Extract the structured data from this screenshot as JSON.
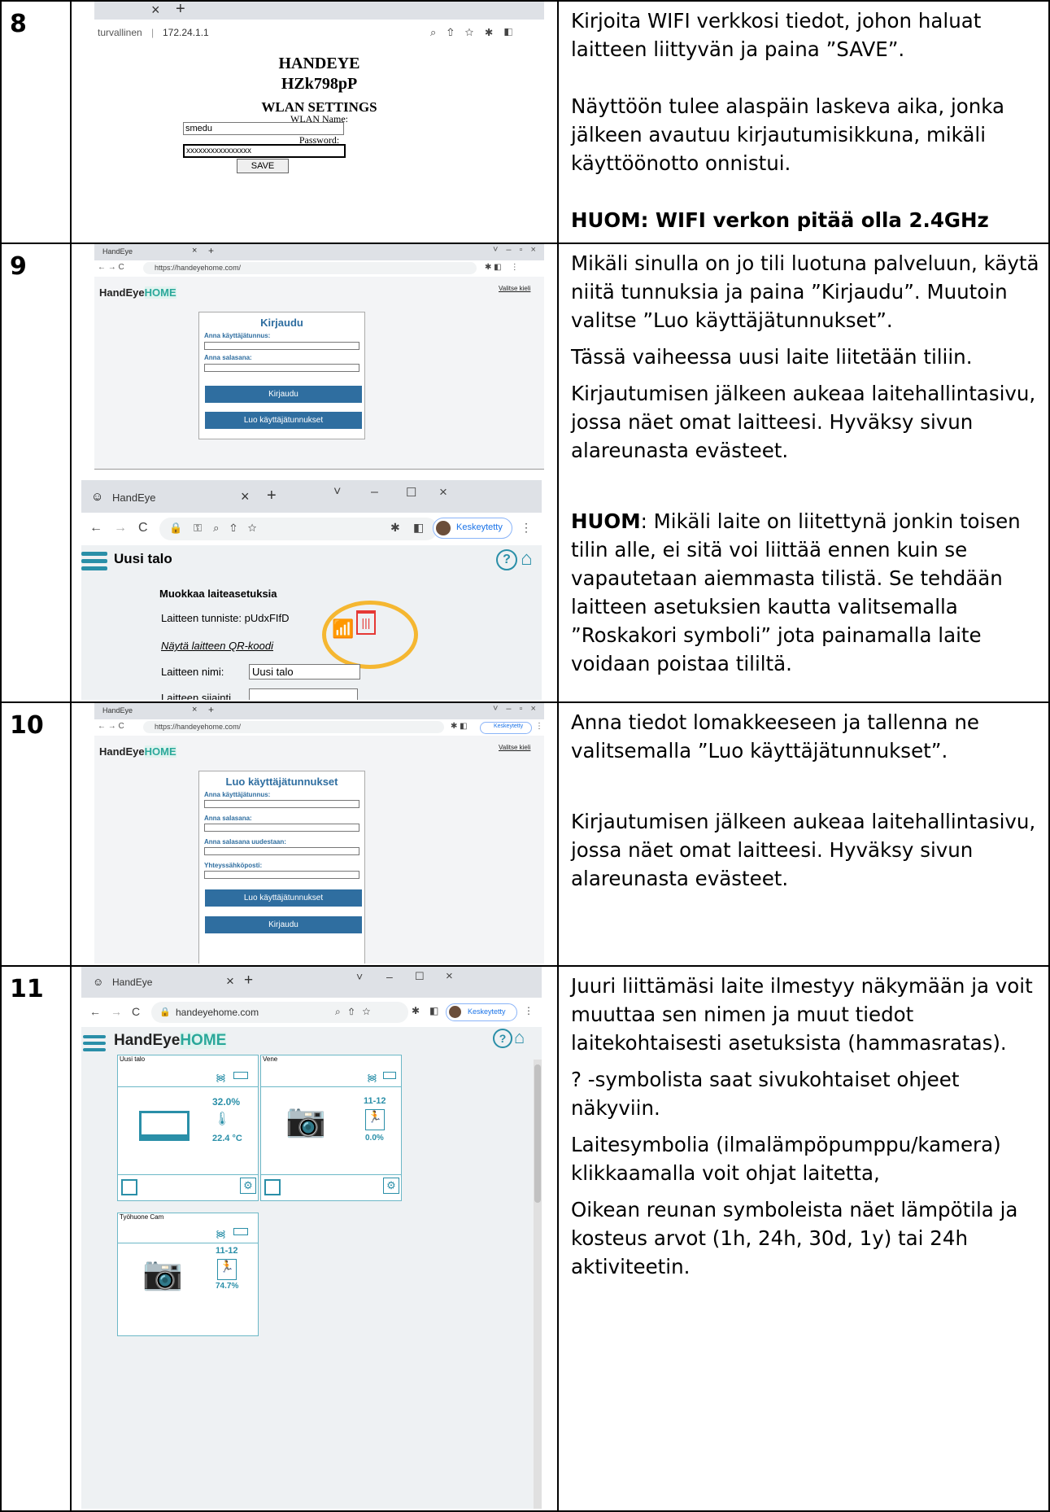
{
  "steps": [
    {
      "number": "8",
      "paragraphs": [
        "Kirjoita WIFI verkkosi tiedot, johon haluat laitteen liittyvän ja paina ”SAVE”.",
        "Näyttöön tulee alaspäin laskeva aika, jonka jälkeen avautuu kirjautumisikkuna, mikäli käyttöönotto onnistui.",
        "HUOM: WIFI verkon pitää olla 2.4GHz"
      ],
      "screenshot": {
        "tab_close": "×",
        "tab_new": "+",
        "address_prefix": "turvallinen",
        "address": "172.24.1.1",
        "brand": "HANDEYE",
        "device_id": "HZk798pP",
        "heading": "WLAN SETTINGS",
        "wlan_name_label": "WLAN Name:",
        "wlan_name_value": "smedu",
        "password_label": "Password:",
        "password_value": "xxxxxxxxxxxxxxxx",
        "save_label": "SAVE"
      }
    },
    {
      "number": "9",
      "paragraphs": [
        "Mikäli sinulla on jo tili luotuna palveluun, käytä niitä tunnuksia ja paina ”Kirjaudu”. Muutoin valitse ”Luo käyttäjätunnukset”.",
        "Tässä vaiheessa uusi laite liitetään tiliin.",
        "Kirjautumisen jälkeen aukeaa laitehallintasivu, jossa näet omat laitteesi. Hyväksy sivun alareunasta evästeet.",
        "HUOM",
        ": Mikäli laite on liitettynä jonkin toisen tilin alle, ei sitä voi liittää ennen kuin se vapautetaan aiemmasta tilistä. Se tehdään laitteen asetuksien kautta valitsemalla ”Roskakori symboli” jota painamalla laite voidaan poistaa tililtä."
      ],
      "screenshot_login": {
        "tab_title": "HandEye",
        "address": "https://handeyehome.com/",
        "logo_a": "HandEye",
        "logo_b": "HOME",
        "language_link": "Valitse kieli",
        "form_title": "Kirjaudu",
        "username_label": "Anna käyttäjätunnus:",
        "password_label": "Anna salasana:",
        "login_button": "Kirjaudu",
        "create_button": "Luo käyttäjätunnukset"
      },
      "screenshot_settings": {
        "tab_title": "HandEye",
        "profile_label": "Keskeytetty",
        "page_title": "Uusi talo",
        "section_title": "Muokkaa laiteasetuksia",
        "device_id_line": "Laitteen tunniste: pUdxFIfD",
        "qr_link": "Näytä laitteen QR-koodi",
        "name_label": "Laitteen nimi:",
        "name_value": "Uusi talo",
        "location_label": "Laitteen sijainti"
      }
    },
    {
      "number": "10",
      "paragraphs": [
        "Anna tiedot lomakkeeseen ja tallenna ne valitsemalla ”Luo käyttäjätunnukset”.",
        "Kirjautumisen jälkeen aukeaa laitehallintasivu, jossa näet omat laitteesi. Hyväksy sivun alareunasta evästeet."
      ],
      "screenshot": {
        "tab_title": "HandEye",
        "address": "https://handeyehome.com/",
        "profile_label": "Keskeytetty",
        "logo_a": "HandEye",
        "logo_b": "HOME",
        "language_link": "Valitse kieli",
        "form_title": "Luo käyttäjätunnukset",
        "username_label": "Anna käyttäjätunnus:",
        "password_label": "Anna salasana:",
        "password2_label": "Anna salasana uudestaan:",
        "email_label": "Yhteyssähköposti:",
        "create_button": "Luo käyttäjätunnukset",
        "login_button": "Kirjaudu"
      }
    },
    {
      "number": "11",
      "paragraphs": [
        "Juuri liittämäsi laite ilmestyy näkymään ja voit muuttaa sen nimen ja muut tiedot laitekohtaisesti asetuksista (hammasratas).",
        "? -symbolista saat sivukohtaiset ohjeet näkyviin.",
        "Laitesymbolia (ilmalämpöpumppu/kamera) klikkaamalla voit ohjat laitetta,",
        "Oikean reunan symboleista näet lämpötila ja kosteus arvot (1h, 24h, 30d, 1y) tai 24h aktiviteetin."
      ],
      "screenshot": {
        "tab_title": "HandEye",
        "address": "handeyehome.com",
        "profile_label": "Keskeytetty",
        "logo_a": "HandEye",
        "logo_b": "HOME",
        "devices": [
          {
            "name": "Uusi talo",
            "humidity": "32.0%",
            "temperature": "22.4 °C"
          },
          {
            "name": "Vene",
            "activity_range": "11-12",
            "activity": "0.0%"
          },
          {
            "name": "Työhuone Cam",
            "activity_range": "11-12",
            "activity": "74.7%"
          }
        ]
      }
    }
  ]
}
